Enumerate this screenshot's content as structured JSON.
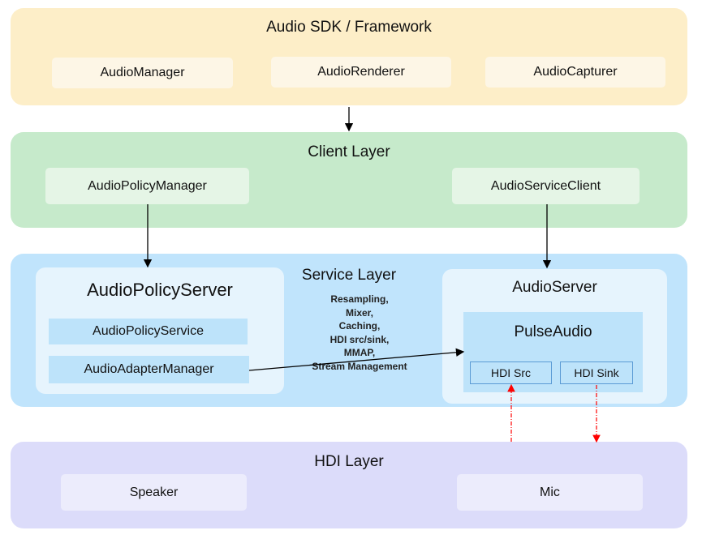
{
  "sdk": {
    "title": "Audio SDK / Framework",
    "items": [
      "AudioManager",
      "AudioRenderer",
      "AudioCapturer"
    ]
  },
  "client": {
    "title": "Client Layer",
    "items": [
      "AudioPolicyManager",
      "AudioServiceClient"
    ]
  },
  "service": {
    "title": "Service Layer",
    "policy_server": {
      "title": "AudioPolicyServer",
      "items": [
        "AudioPolicyService",
        "AudioAdapterManager"
      ]
    },
    "notes": [
      "Resampling,",
      "Mixer,",
      "Caching,",
      "HDI src/sink,",
      "MMAP,",
      "Stream Management"
    ],
    "audio_server": {
      "title": "AudioServer",
      "pulse": {
        "title": "PulseAudio",
        "items": [
          "HDI Src",
          "HDI Sink"
        ]
      }
    }
  },
  "hdi": {
    "title": "HDI Layer",
    "items": [
      "Speaker",
      "Mic"
    ]
  },
  "colors": {
    "sdk": "#fdeec8",
    "client": "#c6eacb",
    "service": "#c0e4fc",
    "hdi": "#dcdcfa",
    "flow": "#ff0000"
  }
}
